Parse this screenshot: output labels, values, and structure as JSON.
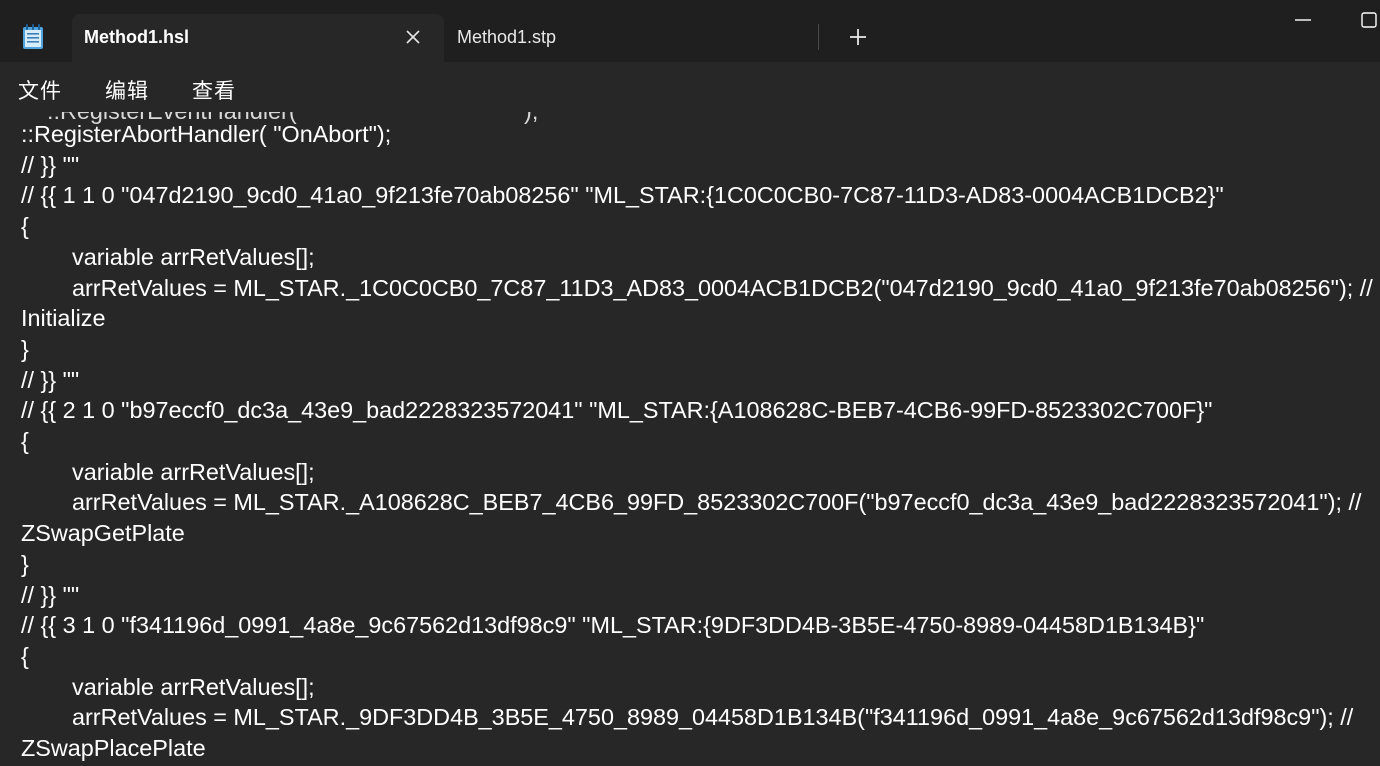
{
  "titlebar": {
    "app_icon": "notepad-icon",
    "tabs": [
      {
        "label": "Method1.hsl",
        "active": true,
        "close_icon": "close-icon"
      },
      {
        "label": "Method1.stp",
        "active": false
      }
    ],
    "new_tab_icon": "plus-icon",
    "window_controls": [
      "minimize-icon",
      "maximize-icon"
    ]
  },
  "menu": {
    "items": [
      {
        "label": "文件"
      },
      {
        "label": "编辑"
      },
      {
        "label": "查看"
      }
    ]
  },
  "editor": {
    "lines": [
      {
        "text": "::RegisterAbortHandler( \"OnAbort\");",
        "indent": false
      },
      {
        "text": "// }} \"\"",
        "indent": false
      },
      {
        "text": "// {{ 1 1 0 \"047d2190_9cd0_41a0_9f213fe70ab08256\" \"ML_STAR:{1C0C0CB0-7C87-11D3-AD83-0004ACB1DCB2}\"",
        "indent": false
      },
      {
        "text": "{",
        "indent": false
      },
      {
        "text": "variable arrRetValues[];",
        "indent": true
      },
      {
        "text": "arrRetValues = ML_STAR._1C0C0CB0_7C87_11D3_AD83_0004ACB1DCB2(\"047d2190_9cd0_41a0_9f213fe70ab08256\"); //",
        "indent": true
      },
      {
        "text": "Initialize",
        "indent": false
      },
      {
        "text": "}",
        "indent": false
      },
      {
        "text": "// }} \"\"",
        "indent": false
      },
      {
        "text": "// {{ 2 1 0 \"b97eccf0_dc3a_43e9_bad2228323572041\" \"ML_STAR:{A108628C-BEB7-4CB6-99FD-8523302C700F}\"",
        "indent": false
      },
      {
        "text": "{",
        "indent": false
      },
      {
        "text": "variable arrRetValues[];",
        "indent": true
      },
      {
        "text": "arrRetValues = ML_STAR._A108628C_BEB7_4CB6_99FD_8523302C700F(\"b97eccf0_dc3a_43e9_bad2228323572041\"); //",
        "indent": true
      },
      {
        "text": "ZSwapGetPlate",
        "indent": false
      },
      {
        "text": "}",
        "indent": false
      },
      {
        "text": "// }} \"\"",
        "indent": false
      },
      {
        "text": "// {{ 3 1 0 \"f341196d_0991_4a8e_9c67562d13df98c9\" \"ML_STAR:{9DF3DD4B-3B5E-4750-8989-04458D1B134B}\"",
        "indent": false
      },
      {
        "text": "{",
        "indent": false
      },
      {
        "text": "variable arrRetValues[];",
        "indent": true
      },
      {
        "text": "arrRetValues = ML_STAR._9DF3DD4B_3B5E_4750_8989_04458D1B134B(\"f341196d_0991_4a8e_9c67562d13df98c9\"); //",
        "indent": true
      },
      {
        "text": "ZSwapPlacePlate",
        "indent": false
      }
    ]
  }
}
